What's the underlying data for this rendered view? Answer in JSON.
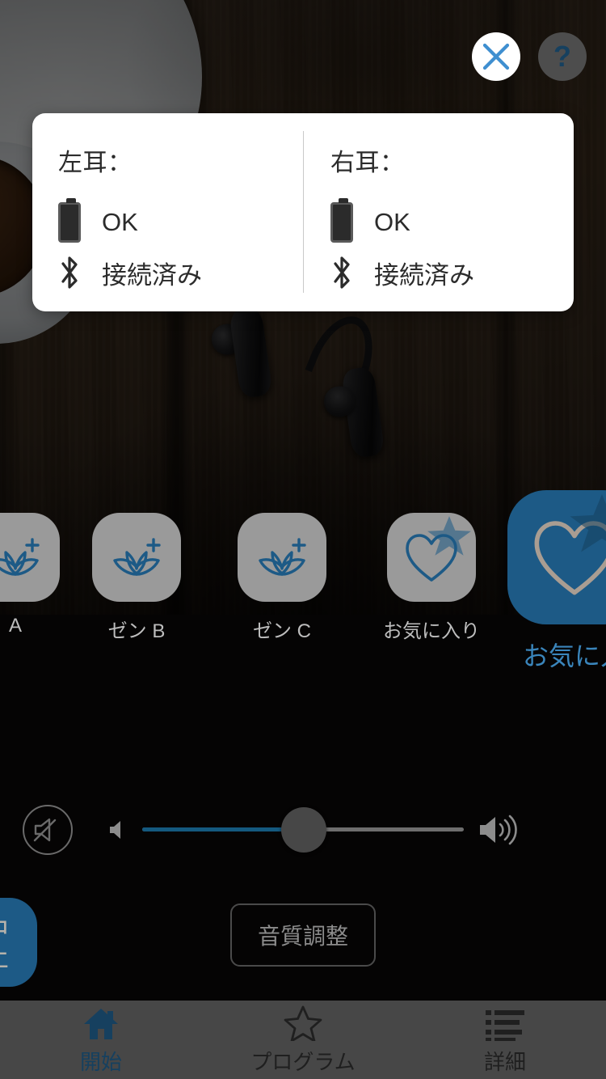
{
  "top_buttons": {
    "close": {
      "icon": "close-icon",
      "label": "×",
      "color": "#3f8fd0"
    },
    "help": {
      "icon": "question-mark-icon",
      "label": "?",
      "color": "#16405f"
    }
  },
  "status_dialog": {
    "left_ear": {
      "title": "左耳：",
      "battery_icon": "battery-icon",
      "battery_status": "OK",
      "bluetooth_icon": "bluetooth-icon",
      "connection_status": "接続済み"
    },
    "right_ear": {
      "title": "右耳：",
      "battery_icon": "battery-icon",
      "battery_status": "OK",
      "bluetooth_icon": "bluetooth-icon",
      "connection_status": "接続済み"
    }
  },
  "programs": [
    {
      "label": "中止",
      "icon": "stop-icon",
      "state": "blue-partial"
    },
    {
      "label": "A",
      "icon": "lotus-plus-icon",
      "state": "normal"
    },
    {
      "label": "ゼン B",
      "icon": "lotus-plus-icon",
      "state": "normal"
    },
    {
      "label": "ゼン C",
      "icon": "lotus-plus-icon",
      "state": "normal"
    },
    {
      "label": "お気に入り",
      "icon": "heart-star-icon",
      "state": "normal"
    },
    {
      "label": "お気に入",
      "icon": "heart-star-icon",
      "state": "selected"
    }
  ],
  "volume": {
    "mute_icon": "mute-speaker-icon",
    "min_icon": "speaker-low-icon",
    "max_icon": "speaker-high-icon",
    "value_percent": 50,
    "fill_color": "#14597f",
    "track_color": "#6e6e6e"
  },
  "sound_quality_button": {
    "label": "音質調整"
  },
  "tabbar": {
    "items": [
      {
        "label": "開始",
        "icon": "home-icon",
        "active": true
      },
      {
        "label": "プログラム",
        "icon": "star-icon",
        "active": false
      },
      {
        "label": "詳細",
        "icon": "list-icon",
        "active": false
      }
    ]
  }
}
